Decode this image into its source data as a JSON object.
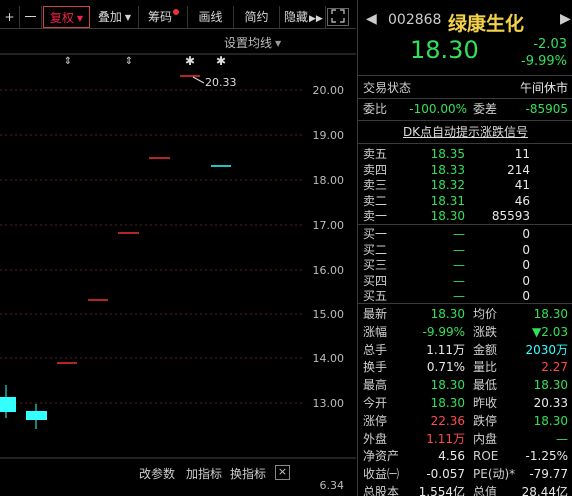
{
  "toolbar": {
    "plus": "+",
    "minus": "一",
    "fuquan": "复权",
    "diejia": "叠加",
    "choumaa": "筹码",
    "huaxian": "画线",
    "jianyue": "简约",
    "yincang": "隐藏"
  },
  "chart": {
    "ma_setting": "设置均线",
    "high_label": "20.33",
    "price_ticks": [
      "20.00",
      "19.00",
      "18.00",
      "17.00",
      "16.00",
      "15.00",
      "14.00",
      "13.00",
      "6.34"
    ],
    "bottom": {
      "gai": "改参数",
      "jia": "加指标",
      "huan": "换指标",
      "close": "×"
    }
  },
  "stock": {
    "code": "002868",
    "name": "绿康生化",
    "price": "18.30",
    "change": "-2.03",
    "change_pct": "-9.99%",
    "status_label": "交易状态",
    "status_value": "午间休市",
    "weibi_label": "委比",
    "weibi_value": "-100.00%",
    "weicha_label": "委差",
    "weicha_value": "-85905",
    "signal_link": "DK点自动提示涨跌信号"
  },
  "orderbook": {
    "sells": [
      {
        "label": "卖五",
        "price": "18.35",
        "vol": "11"
      },
      {
        "label": "卖四",
        "price": "18.33",
        "vol": "214"
      },
      {
        "label": "卖三",
        "price": "18.32",
        "vol": "41"
      },
      {
        "label": "卖二",
        "price": "18.31",
        "vol": "46"
      },
      {
        "label": "卖一",
        "price": "18.30",
        "vol": "85593"
      }
    ],
    "buys": [
      {
        "label": "买一",
        "price": "—",
        "vol": "0"
      },
      {
        "label": "买二",
        "price": "—",
        "vol": "0"
      },
      {
        "label": "买三",
        "price": "—",
        "vol": "0"
      },
      {
        "label": "买四",
        "price": "—",
        "vol": "0"
      },
      {
        "label": "买五",
        "price": "—",
        "vol": "0"
      }
    ]
  },
  "quote": [
    {
      "l1": "最新",
      "v1": "18.30",
      "c1": "green",
      "l2": "均价",
      "v2": "18.30",
      "c2": "green"
    },
    {
      "l1": "涨幅",
      "v1": "-9.99%",
      "c1": "green",
      "l2": "涨跌",
      "v2": "▼2.03",
      "c2": "green"
    },
    {
      "l1": "总手",
      "v1": "1.11万",
      "c1": "white",
      "l2": "金额",
      "v2": "2030万",
      "c2": "cyan"
    },
    {
      "l1": "换手",
      "v1": "0.71%",
      "c1": "white",
      "l2": "量比",
      "v2": "2.27",
      "c2": "red"
    },
    {
      "l1": "最高",
      "v1": "18.30",
      "c1": "green",
      "l2": "最低",
      "v2": "18.30",
      "c2": "green"
    },
    {
      "l1": "今开",
      "v1": "18.30",
      "c1": "green",
      "l2": "昨收",
      "v2": "20.33",
      "c2": "white"
    },
    {
      "l1": "涨停",
      "v1": "22.36",
      "c1": "red",
      "l2": "跌停",
      "v2": "18.30",
      "c2": "green"
    },
    {
      "l1": "外盘",
      "v1": "1.11万",
      "c1": "red",
      "l2": "内盘",
      "v2": "—",
      "c2": "green"
    },
    {
      "l1": "净资产",
      "v1": "4.56",
      "c1": "white",
      "l2": "ROE",
      "v2": "-1.25%",
      "c2": "white"
    },
    {
      "l1": "收益㈠",
      "v1": "-0.057",
      "c1": "white",
      "l2": "PE(动)*",
      "v2": "-79.77",
      "c2": "white"
    },
    {
      "l1": "总股本",
      "v1": "1.554亿",
      "c1": "white",
      "l2": "总值",
      "v2": "28.44亿",
      "c2": "white"
    }
  ]
}
